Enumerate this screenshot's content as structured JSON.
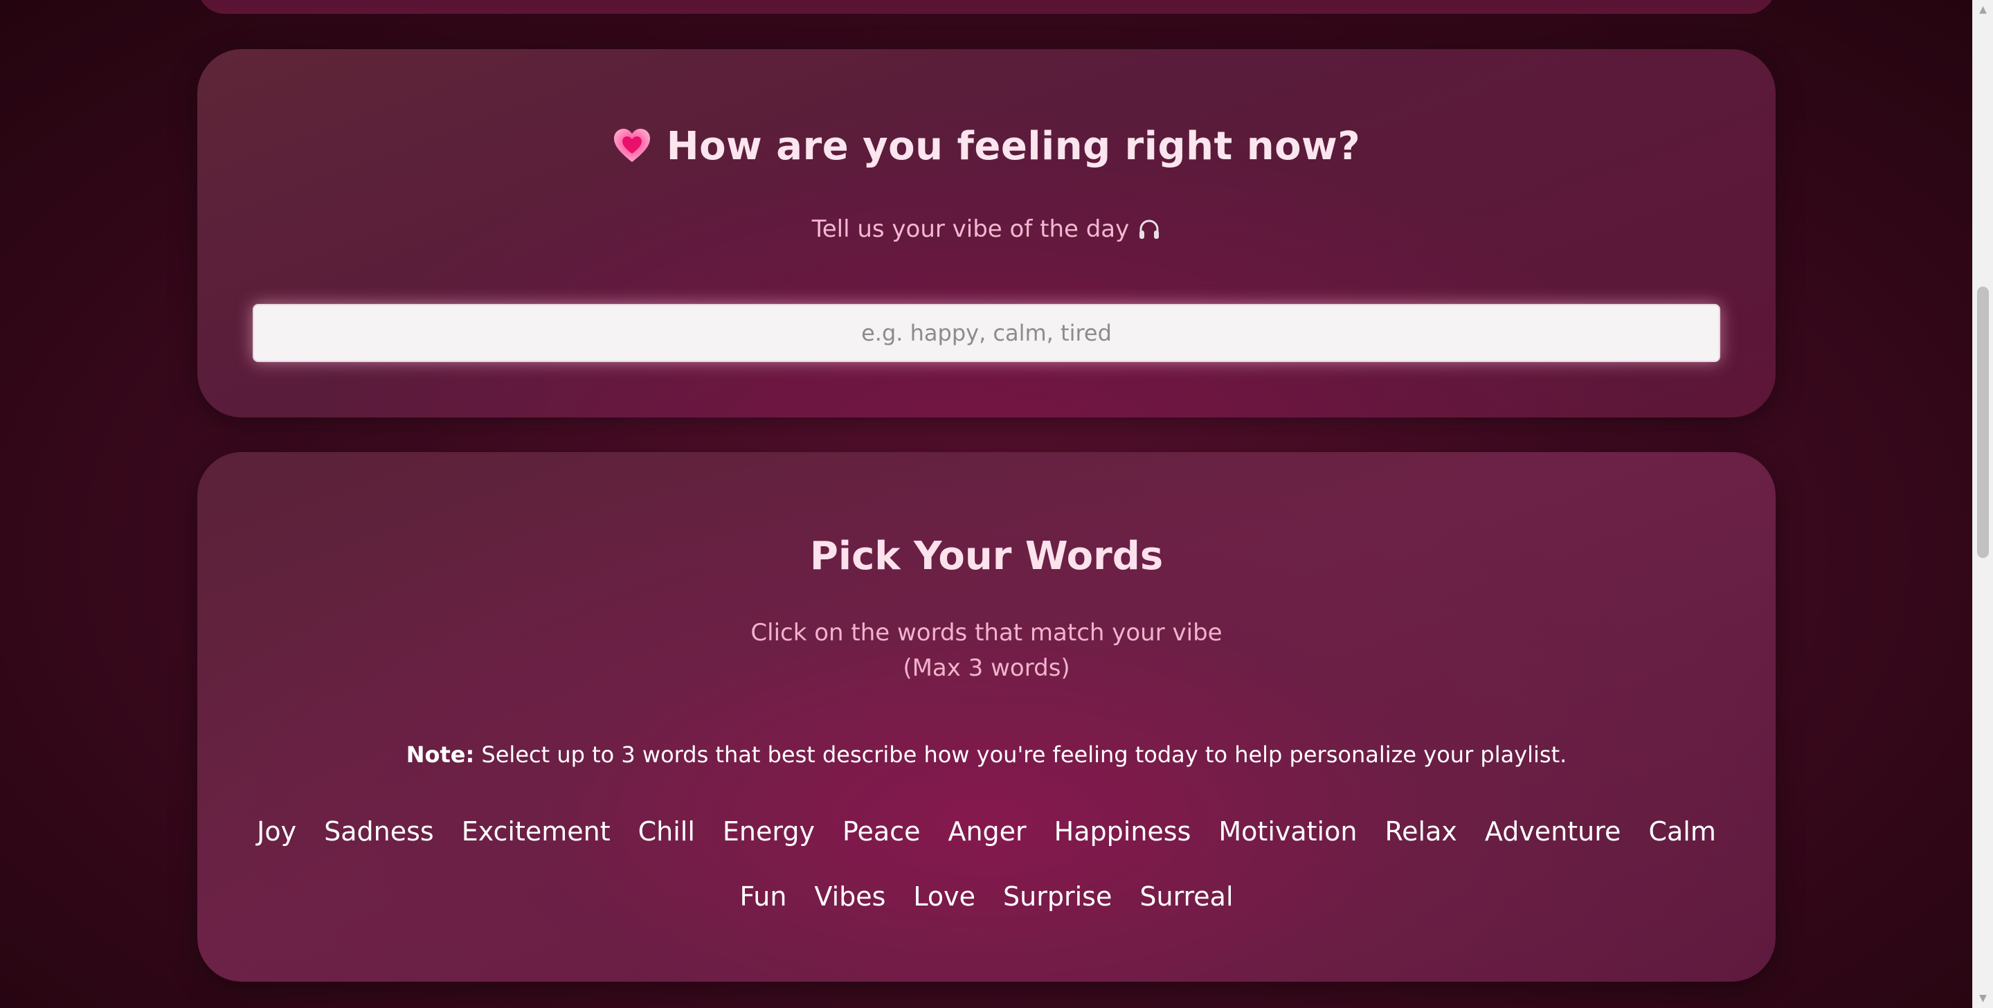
{
  "feeling_card": {
    "title": "How are you feeling right now?",
    "subtitle": "Tell us your vibe of the day",
    "heart_icon": "heart-icon",
    "headphones_icon": "headphones-icon",
    "input_placeholder": "e.g. happy, calm, tired",
    "input_value": ""
  },
  "words_card": {
    "title": "Pick Your Words",
    "subtitle_line1": "Click on the words that match your vibe",
    "subtitle_line2": "(Max 3 words)",
    "note_label": "Note:",
    "note_text": " Select up to 3 words that best describe how you're feeling today to help personalize your playlist.",
    "words_row1": [
      "Joy",
      "Sadness",
      "Excitement",
      "Chill",
      "Energy",
      "Peace",
      "Anger",
      "Happiness",
      "Motivation",
      "Relax",
      "Adventure",
      "Calm"
    ],
    "words_row2": [
      "Fun",
      "Vibes",
      "Love",
      "Surprise",
      "Surreal"
    ]
  },
  "colors": {
    "background": "#3e0a20",
    "card": "#5e1a3e",
    "title_text": "#fbe5ee",
    "subtitle_text": "#f4b9d1",
    "word_text": "#ffffff"
  }
}
